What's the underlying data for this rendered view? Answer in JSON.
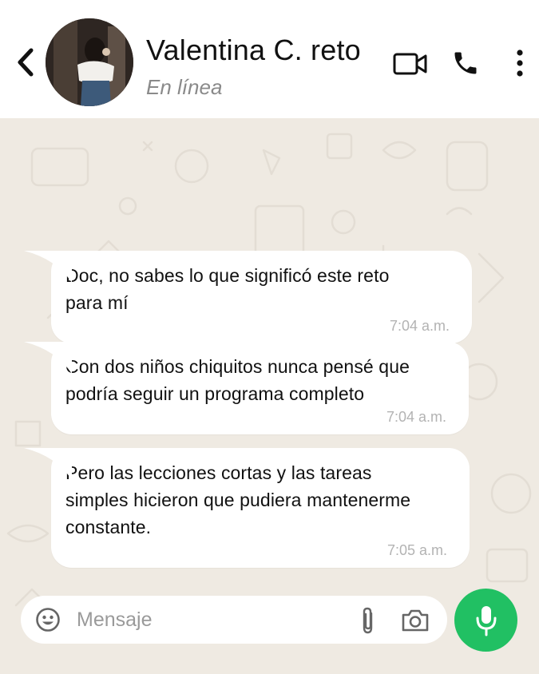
{
  "header": {
    "contact_name": "Valentina C. reto",
    "status": "En línea"
  },
  "messages": [
    {
      "text": "Doc, no sabes lo que significó este reto\npara mí",
      "time": "7:04 a.m."
    },
    {
      "text": "Con dos niños chiquitos nunca pensé que\npodría seguir un programa completo",
      "time": "7:04 a.m."
    },
    {
      "text": "Pero las lecciones cortas y las tareas\nsimples hicieron que pudiera mantenerme\nconstante.",
      "time": "7:05 a.m."
    }
  ],
  "composer": {
    "placeholder": "Mensaje",
    "value": ""
  },
  "colors": {
    "chat_background": "#efeae2",
    "send_button": "#21c063",
    "bubble": "#ffffff"
  },
  "icons": [
    "back-arrow-icon",
    "video-call-icon",
    "phone-icon",
    "more-options-icon",
    "emoji-icon",
    "attach-icon",
    "camera-icon",
    "microphone-icon"
  ]
}
